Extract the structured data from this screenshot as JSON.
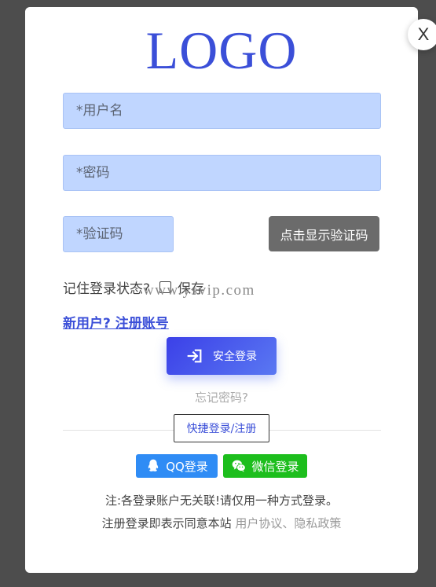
{
  "dialog": {
    "close_label": "X",
    "logo_text": "LOGO"
  },
  "form": {
    "username_placeholder": "*用户名",
    "password_placeholder": "*密码",
    "captcha_placeholder": "*验证码",
    "captcha_button": "点击显示验证码",
    "remember_label": "记住登录状态?",
    "save_label": "保存",
    "register_link": "新用户? 注册账号",
    "login_button": "安全登录",
    "forgot_link": "忘记密码?",
    "quick_login": "快捷登录/注册"
  },
  "watermark": "www.ysvip.com",
  "social": {
    "qq_label": "QQ登录",
    "wechat_label": "微信登录"
  },
  "footer": {
    "note": "注:各登录账户无关联!请仅用一种方式登录。",
    "agree_prefix": "注册登录即表示同意本站",
    "terms": "用户协议",
    "separator": "、",
    "privacy": "隐私政策"
  },
  "colors": {
    "accent": "#3b4fd8",
    "input_bg": "#c0d6ff",
    "qq": "#2f8cf5",
    "wechat": "#1dbe1d",
    "overlay": "#4d4d4d"
  }
}
